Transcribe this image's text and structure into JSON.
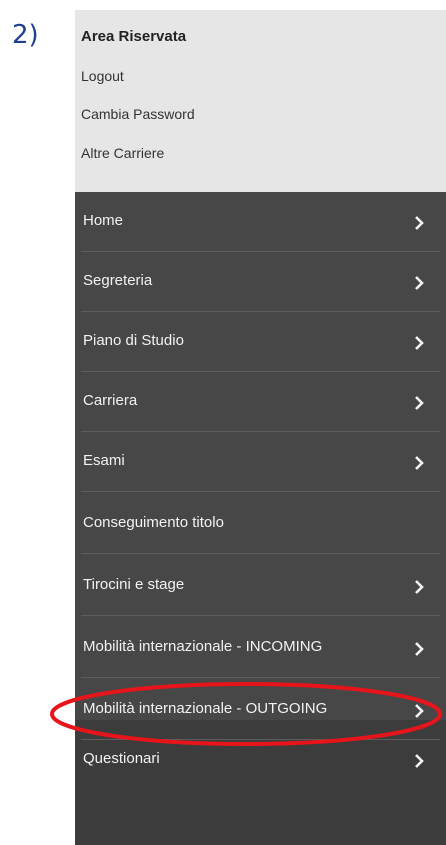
{
  "step_label": "2)",
  "reserved_area": {
    "title": "Area Riservata",
    "links": [
      "Logout",
      "Cambia Password",
      "Altre Carriere"
    ]
  },
  "menu": [
    {
      "label": "Home",
      "has_chevron": true
    },
    {
      "label": "Segreteria",
      "has_chevron": true
    },
    {
      "label": "Piano di Studio",
      "has_chevron": true
    },
    {
      "label": "Carriera",
      "has_chevron": true
    },
    {
      "label": "Esami",
      "has_chevron": true
    },
    {
      "label": "Conseguimento titolo",
      "has_chevron": false
    },
    {
      "label": "Tirocini e stage",
      "has_chevron": true
    },
    {
      "label": "Mobilità internazionale - INCOMING",
      "has_chevron": true
    },
    {
      "label": "Mobilità internazionale - OUTGOING",
      "has_chevron": true,
      "highlighted": true
    },
    {
      "label": "Questionari",
      "has_chevron": true
    }
  ],
  "colors": {
    "menu_bg": "#474747",
    "reserved_bg": "#e6e6e6",
    "highlight": "#e8141b",
    "step_label": "#1f3f8f"
  },
  "icons": {
    "chevron": "chevron-right-icon"
  }
}
